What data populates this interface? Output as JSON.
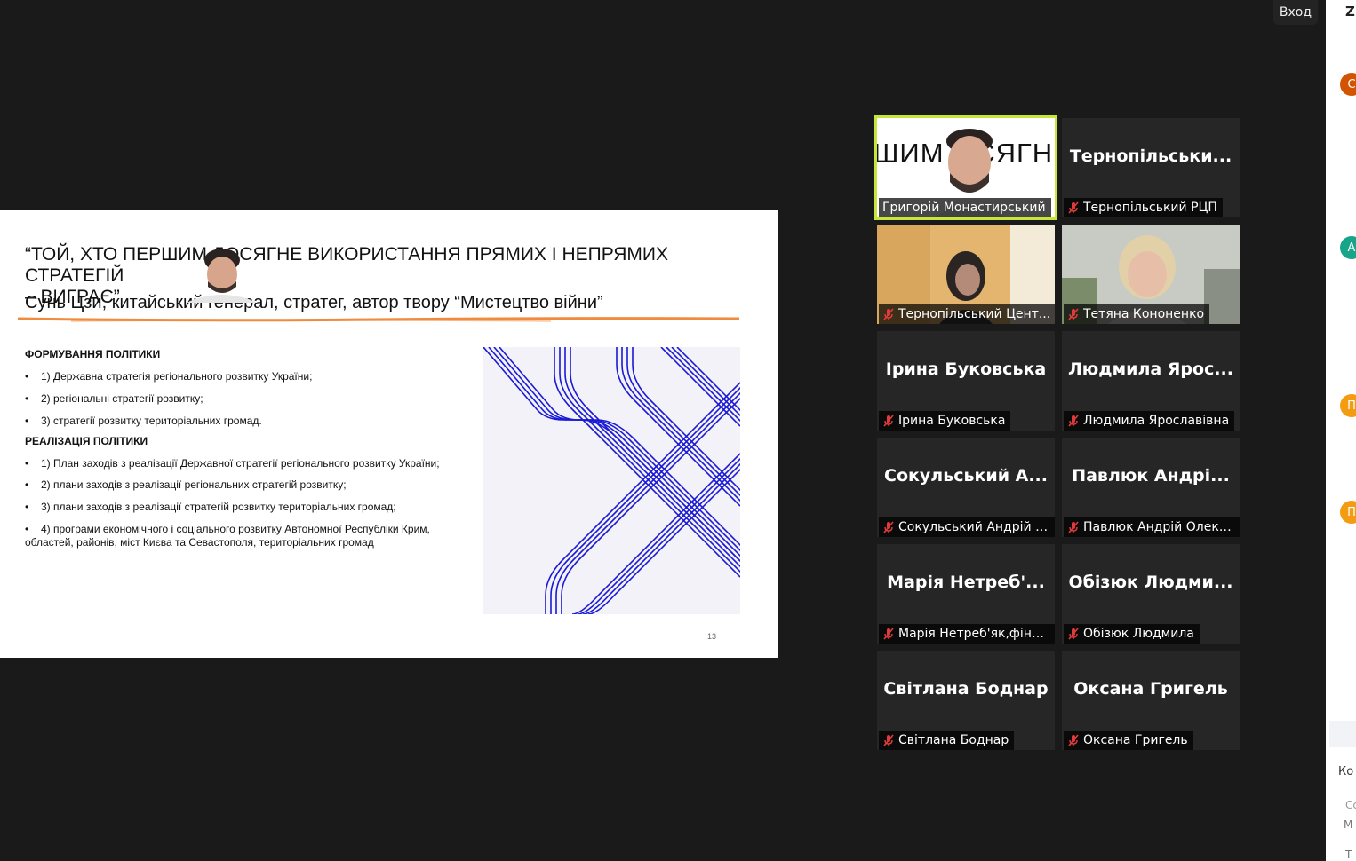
{
  "signin_label": "Вход",
  "side_panel": {
    "logo": "Z",
    "avatars": [
      {
        "letter": "С",
        "color": "#d35400"
      },
      {
        "letter": "А",
        "color": "#17a589"
      },
      {
        "letter": "П",
        "color": "#f39c12"
      },
      {
        "letter": "П",
        "color": "#f39c12"
      }
    ],
    "chat_header": "Ко",
    "input_line1": "Сс",
    "input_line2": "М",
    "footer_line": "Т"
  },
  "slide": {
    "quote_line1": "“ТОЙ, ХТО ПЕРШИМ ДОСЯГНЕ ВИКОРИСТАННЯ ПРЯМИХ І НЕПРЯМИХ СТРАТЕГІЙ",
    "quote_line2": "– ВИГРАЄ”",
    "author": "Сунь Цзи, китайський генерал, стратег, автор твору “Мистецтво війни”",
    "section1_title": "ФОРМУВАННЯ ПОЛІТИКИ",
    "section1_items": [
      "1) Державна стратегія регіонального розвитку України;",
      "2) регіональні стратегії розвитку;",
      "3) стратегії розвитку територіальних громад."
    ],
    "section2_title": "РЕАЛІЗАЦІЯ ПОЛІТИКИ",
    "section2_items": [
      "1) План заходів з реалізації Державної стратегії регіонального розвитку України;",
      "2) плани заходів з реалізації регіональних стратегій розвитку;",
      "3) плани заходів з реалізації стратегій розвитку територіальних громад;",
      "4) програми економічного і соціального розвитку Автономної Республіки Крим, областей, районів, міст Києва та Севастополя, територіальних громад"
    ],
    "bullet": "•",
    "page_number": "13",
    "accent_color": "#f08a3c",
    "pattern_color": "#1a1ad6"
  },
  "participants": [
    {
      "display": "",
      "label": "Григорій Монастирський",
      "muted": false,
      "active": true,
      "video": "speaker"
    },
    {
      "display": "Тернопільськи...",
      "label": "Тернопільський РЦП",
      "muted": true
    },
    {
      "display": "",
      "label": "Тернопільський Цент...",
      "muted": true,
      "video": "woman1"
    },
    {
      "display": "",
      "label": "Тетяна Кононенко",
      "muted": true,
      "video": "woman2"
    },
    {
      "display": "Ірина Буковська",
      "label": "Ірина Буковська",
      "muted": true
    },
    {
      "display": "Людмила Ярос...",
      "label": "Людмила Ярославівна",
      "muted": true
    },
    {
      "display": "Сокульський А...",
      "label": "Сокульський Андрій (...",
      "muted": true
    },
    {
      "display": "Павлюк Андрі...",
      "label": "Павлюк Андрій Олекс...",
      "muted": true
    },
    {
      "display": "Марія Нетреб'...",
      "label": "Марія Нетреб'як,фінві...",
      "muted": true
    },
    {
      "display": "Обізюк Людми...",
      "label": "Обізюк Людмила",
      "muted": true
    },
    {
      "display": "Світлана Боднар",
      "label": "Світлана Боднар",
      "muted": true
    },
    {
      "display": "Оксана Григель",
      "label": "Оксана Григель",
      "muted": true
    }
  ],
  "speaker_tile_bg_text": "ШИМ ОСЯГНЕ"
}
